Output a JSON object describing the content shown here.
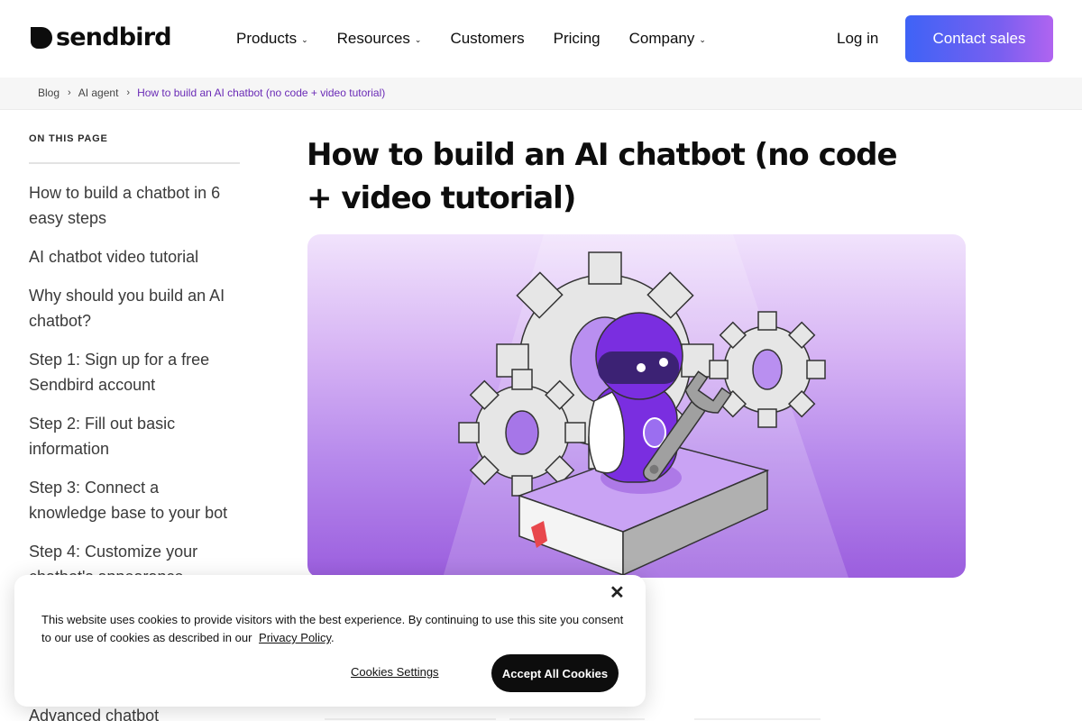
{
  "header": {
    "brand": "sendbird",
    "nav": [
      {
        "label": "Products",
        "has_dropdown": true
      },
      {
        "label": "Resources",
        "has_dropdown": true
      },
      {
        "label": "Customers",
        "has_dropdown": false
      },
      {
        "label": "Pricing",
        "has_dropdown": false
      },
      {
        "label": "Company",
        "has_dropdown": true
      }
    ],
    "login_label": "Log in",
    "contact_label": "Contact sales",
    "chevron": "⌄"
  },
  "breadcrumb": {
    "items": [
      "Blog",
      "AI agent"
    ],
    "current": "How to build an AI chatbot (no code + video tutorial)",
    "separator": "›"
  },
  "toc": {
    "title": "ON THIS PAGE",
    "items": [
      "How to build a chatbot in 6 easy steps",
      "AI chatbot video tutorial",
      "Why should you build an AI chatbot?",
      "Step 1: Sign up for a free Sendbird account",
      "Step 2: Fill out basic information",
      "Step 3: Connect a knowledge base to your bot",
      "Step 4: Customize your chatbot's appearance",
      "Advanced chatbot"
    ]
  },
  "article": {
    "title": "How to build an AI chatbot (no code + video tutorial)",
    "hero_alt": "Purple robot with gears, wrench and book illustration"
  },
  "cookie_banner": {
    "close_glyph": "✕",
    "text": "This website uses cookies to provide visitors with the best experience. By continuing to use this site you consent to our use of cookies as described in our",
    "link_label": "Privacy Policy",
    "period": ".",
    "settings_label": "Cookies Settings",
    "accept_label": "Accept All Cookies"
  },
  "colors": {
    "accent_purple": "#6a2bb6",
    "cta_gradient_start": "#3e63f6",
    "cta_gradient_end": "#b064f0"
  }
}
